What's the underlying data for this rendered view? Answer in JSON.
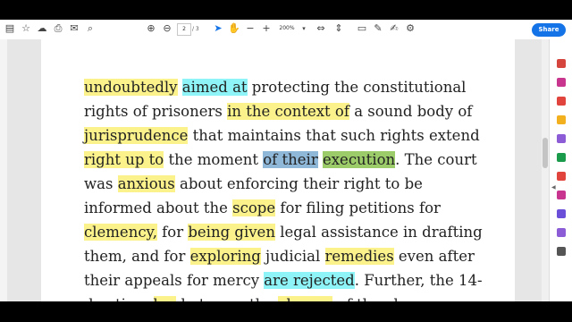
{
  "toolbar": {
    "left_icons": [
      "file-icon",
      "star-icon",
      "upload-icon",
      "print-icon",
      "email-icon",
      "search-icon"
    ],
    "nav_icons": [
      "page-up-icon",
      "page-down-icon"
    ],
    "page_current": "2",
    "page_total": "/ 3",
    "tool_icons": [
      "select-icon",
      "hand-icon",
      "zoom-out-icon",
      "zoom-in-icon"
    ],
    "zoom_value": "200%",
    "right_icons": [
      "fit-icon",
      "scroll-icon",
      "comment-icon",
      "pen-icon",
      "sign-icon",
      "more-tools-icon"
    ],
    "share_label": "Share"
  },
  "document": {
    "lines": [
      [
        {
          "t": "undoubtedly",
          "h": "y"
        },
        {
          "t": " "
        },
        {
          "t": "aimed at",
          "h": "c"
        },
        {
          "t": " protecting the constitutional"
        }
      ],
      [
        {
          "t": "rights of prisoners "
        },
        {
          "t": "in the context of",
          "h": "y"
        },
        {
          "t": " a sound body of"
        }
      ],
      [
        {
          "t": "jurisprudence",
          "h": "y"
        },
        {
          "t": " that maintains that such rights extend"
        }
      ],
      [
        {
          "t": "right up to",
          "h": "y"
        },
        {
          "t": " the moment "
        },
        {
          "t": "of their",
          "h": "b"
        },
        {
          "t": " "
        },
        {
          "t": "execution",
          "h": "g"
        },
        {
          "t": ". The court"
        }
      ],
      [
        {
          "t": "was "
        },
        {
          "t": "anxious",
          "h": "y"
        },
        {
          "t": " about enforcing their right to be"
        }
      ],
      [
        {
          "t": "informed about the "
        },
        {
          "t": "scope",
          "h": "y"
        },
        {
          "t": " for filing petitions for"
        }
      ],
      [
        {
          "t": "clemency,",
          "h": "y"
        },
        {
          "t": " for "
        },
        {
          "t": "being given",
          "h": "y"
        },
        {
          "t": " legal assistance in drafting"
        }
      ],
      [
        {
          "t": "them, and for "
        },
        {
          "t": "exploring",
          "h": "y"
        },
        {
          "t": " judicial "
        },
        {
          "t": "remedies",
          "h": "y"
        },
        {
          "t": " even after"
        }
      ],
      [
        {
          "t": "their appeals for mercy "
        },
        {
          "t": "are rejected",
          "h": "c"
        },
        {
          "t": ". Further, the 14-"
        }
      ],
      [
        {
          "t": "day time "
        },
        {
          "t": "lag",
          "h": "y"
        },
        {
          "t": " between the "
        },
        {
          "t": "closure",
          "h": "y"
        },
        {
          "t": " of the clemency"
        }
      ]
    ]
  },
  "highlight_colors": {
    "yellow": "#fbf28c",
    "cyan": "#8ef4f7",
    "blue": "#8fb7d8",
    "green": "#9ccc6a"
  },
  "right_rail": {
    "icons": [
      {
        "name": "export-pdf-icon",
        "color": "#d6453d"
      },
      {
        "name": "edit-pdf-icon",
        "color": "#c8358f"
      },
      {
        "name": "create-pdf-icon",
        "color": "#e0443c"
      },
      {
        "name": "comment-icon",
        "color": "#f2b01e"
      },
      {
        "name": "combine-icon",
        "color": "#8c5bd6"
      },
      {
        "name": "organize-icon",
        "color": "#1a9b4b"
      },
      {
        "name": "compress-icon",
        "color": "#e0443c"
      },
      {
        "name": "redact-icon",
        "color": "#c8358f"
      },
      {
        "name": "protect-icon",
        "color": "#6b4fd8"
      },
      {
        "name": "fill-sign-icon",
        "color": "#8c5bd6"
      },
      {
        "name": "more-tools-icon",
        "color": "#555555"
      }
    ]
  }
}
